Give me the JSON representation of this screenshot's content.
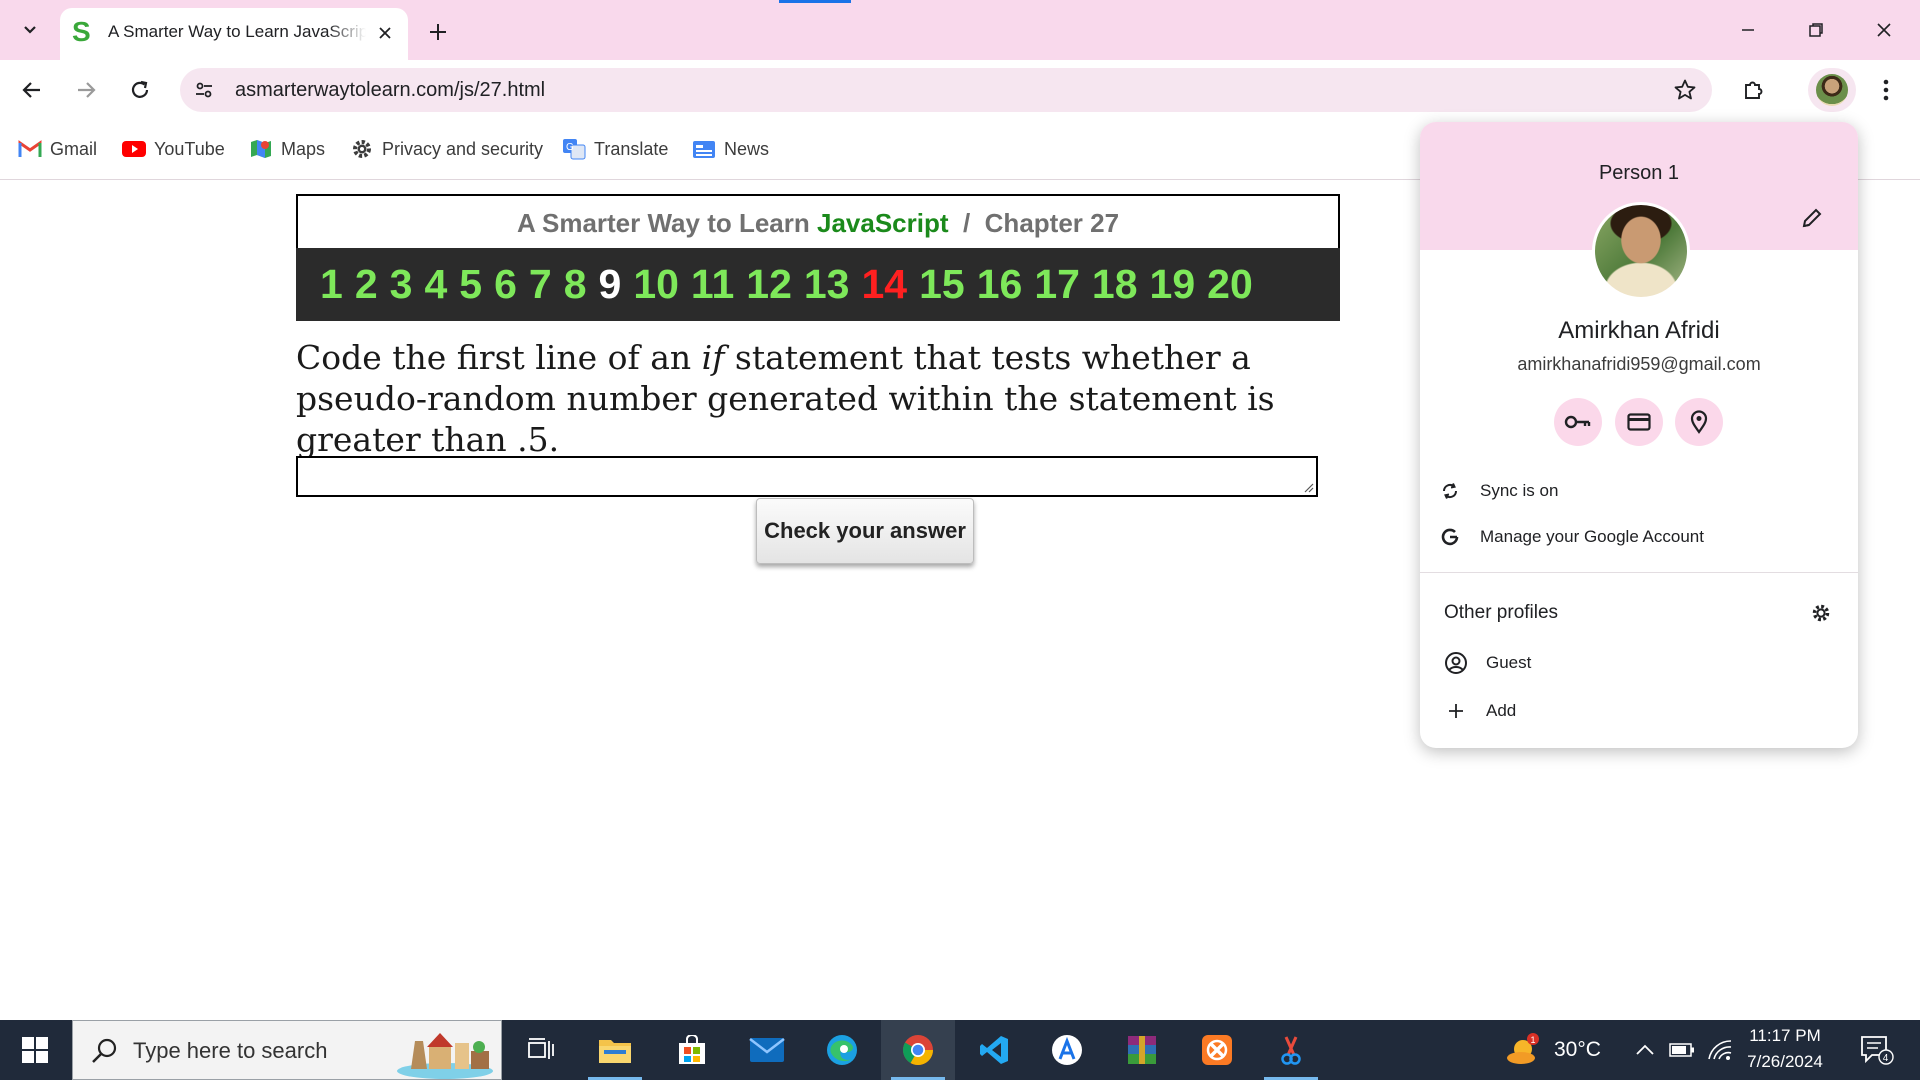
{
  "browser": {
    "tab_title": "A Smarter Way to Learn JavaScript",
    "tab_favicon": "S",
    "url": "asmarterwaytolearn.com/js/27.html",
    "accent_color": "#f9d9ec"
  },
  "bookmarks": [
    {
      "label": "Gmail",
      "icon": "gmail-icon"
    },
    {
      "label": "YouTube",
      "icon": "youtube-icon"
    },
    {
      "label": "Maps",
      "icon": "maps-icon"
    },
    {
      "label": "Privacy and security",
      "icon": "gear-icon"
    },
    {
      "label": "Translate",
      "icon": "translate-icon"
    },
    {
      "label": "News",
      "icon": "news-icon"
    }
  ],
  "page": {
    "header_prefix": "A Smarter Way to Learn ",
    "header_js": "JavaScript",
    "header_sep": "  /  ",
    "header_chapter": "Chapter 27",
    "chapter_numbers": [
      "1",
      "2",
      "3",
      "4",
      "5",
      "6",
      "7",
      "8",
      "9",
      "10",
      "11",
      "12",
      "13",
      "14",
      "15",
      "16",
      "17",
      "18",
      "19",
      "20"
    ],
    "current_number": "9",
    "highlight_number": "14",
    "question_before": "Code the first line of an ",
    "question_italic": "if",
    "question_after": " statement that tests whether a pseudo-random number generated within the statement is greater than .5.",
    "answer_value": "",
    "check_button": "Check your answer"
  },
  "profile": {
    "person_label": "Person 1",
    "name": "Amirkhan Afridi",
    "email": "amirkhanafridi959@gmail.com",
    "sync": "Sync is on",
    "manage": "Manage your Google Account",
    "other_profiles": "Other profiles",
    "guest": "Guest",
    "add": "Add"
  },
  "taskbar": {
    "search_placeholder": "Type here to search",
    "weather_temp": "30°C",
    "weather_badge": "1",
    "time": "11:17 PM",
    "date": "7/26/2024",
    "notification_count": "4"
  }
}
